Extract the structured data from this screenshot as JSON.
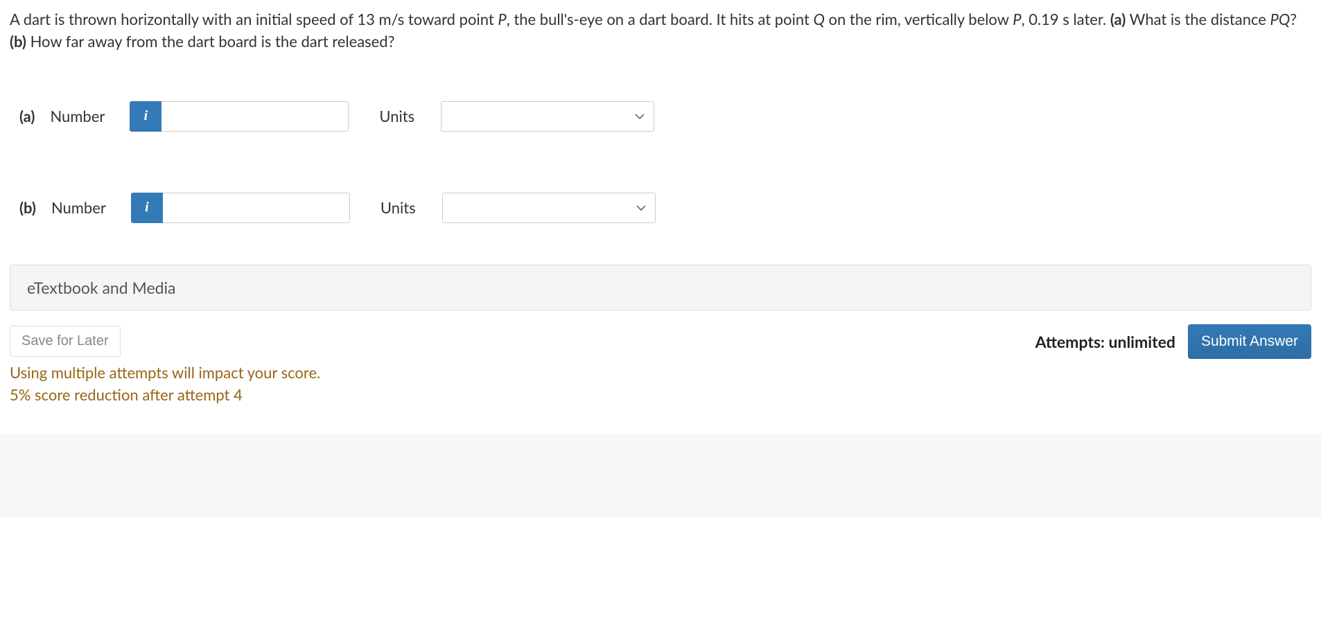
{
  "question": {
    "prefix": "A dart is thrown horizontally with an initial speed of 13 m/s toward point ",
    "p1": "P",
    "mid1": ", the bull's-eye on a dart board. It hits at point ",
    "q": "Q",
    "mid2": " on the rim, vertically below ",
    "p2": "P",
    "mid3": ", 0.19 s later. ",
    "partA_b": "(a)",
    "partA_txt": " What is the distance ",
    "pq": "PQ",
    "partA_end": "? ",
    "partB_b": "(b)",
    "partB_txt": " How far away from the dart board is the dart released?"
  },
  "inputs": {
    "a": {
      "part": "(a)",
      "label": "Number",
      "info": "i",
      "value": "",
      "units_label": "Units",
      "units_value": ""
    },
    "b": {
      "part": "(b)",
      "label": "Number",
      "info": "i",
      "value": "",
      "units_label": "Units",
      "units_value": ""
    }
  },
  "accordion": {
    "title": "eTextbook and Media"
  },
  "footer": {
    "save": "Save for Later",
    "attempts": "Attempts: unlimited",
    "submit": "Submit Answer",
    "policy_line1": "Using multiple attempts will impact your score.",
    "policy_line2": "5% score reduction after attempt 4"
  }
}
